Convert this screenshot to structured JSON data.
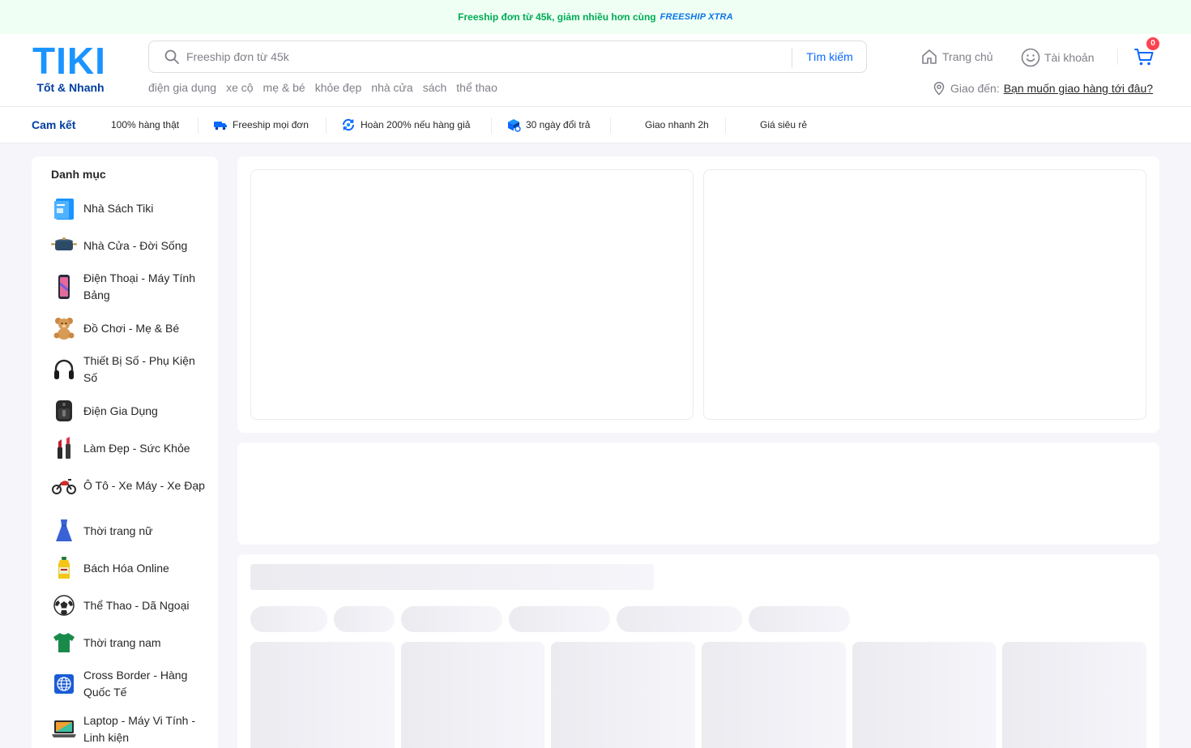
{
  "promo": {
    "text": "Freeship đơn từ 45k, giảm nhiều hơn cùng",
    "badge": "FREESHIP XTRA"
  },
  "logo": {
    "brand": "TIKI",
    "tagline": "Tốt & Nhanh"
  },
  "search": {
    "placeholder": "Freeship đơn từ 45k",
    "button_label": "Tìm kiếm"
  },
  "quick_links": [
    "điện gia dụng",
    "xe cộ",
    "mẹ & bé",
    "khỏe đẹp",
    "nhà cửa",
    "sách",
    "thể thao"
  ],
  "nav": {
    "home_label": "Trang chủ",
    "account_label": "Tài khoản",
    "cart_count": "0"
  },
  "delivery": {
    "label": "Giao đến:",
    "link": "Bạn muốn giao hàng tới đâu?"
  },
  "commitments": {
    "title": "Cam kết",
    "items": [
      "100% hàng thật",
      "Freeship mọi đơn",
      "Hoàn 200% nếu hàng giả",
      "30 ngày đổi trả",
      "Giao nhanh 2h",
      "Giá siêu rẻ"
    ]
  },
  "sidebar": {
    "title": "Danh mục",
    "items": [
      {
        "label": "Nhà Sách Tiki",
        "icon": "book-icon"
      },
      {
        "label": "Nhà Cửa - Đời Sống",
        "icon": "cooking-pot-icon"
      },
      {
        "label": "Điện Thoại - Máy Tính Bảng",
        "icon": "smartphone-icon"
      },
      {
        "label": "Đồ Chơi - Mẹ & Bé",
        "icon": "teddy-bear-icon"
      },
      {
        "label": "Thiết Bị Số - Phụ Kiện Số",
        "icon": "headphones-icon"
      },
      {
        "label": "Điện Gia Dụng",
        "icon": "air-fryer-icon"
      },
      {
        "label": "Làm Đẹp - Sức Khỏe",
        "icon": "lipstick-icon"
      },
      {
        "label": "Ô Tô - Xe Máy - Xe Đạp",
        "icon": "motorbike-icon"
      },
      {
        "label": "Thời trang nữ",
        "icon": "dress-icon"
      },
      {
        "label": "Bách Hóa Online",
        "icon": "oil-bottle-icon"
      },
      {
        "label": "Thể Thao - Dã Ngoại",
        "icon": "soccer-ball-icon"
      },
      {
        "label": "Thời trang nam",
        "icon": "tshirt-icon"
      },
      {
        "label": "Cross Border - Hàng Quốc Tế",
        "icon": "globe-icon"
      },
      {
        "label": "Laptop - Máy Vi Tính - Linh kiện",
        "icon": "laptop-icon"
      }
    ]
  },
  "colors": {
    "brand_blue": "#1a94ff",
    "brand_dark": "#003ea1",
    "accent_green": "#00ab56",
    "badge_red": "#ff424f",
    "link_blue": "#0a68ff"
  }
}
